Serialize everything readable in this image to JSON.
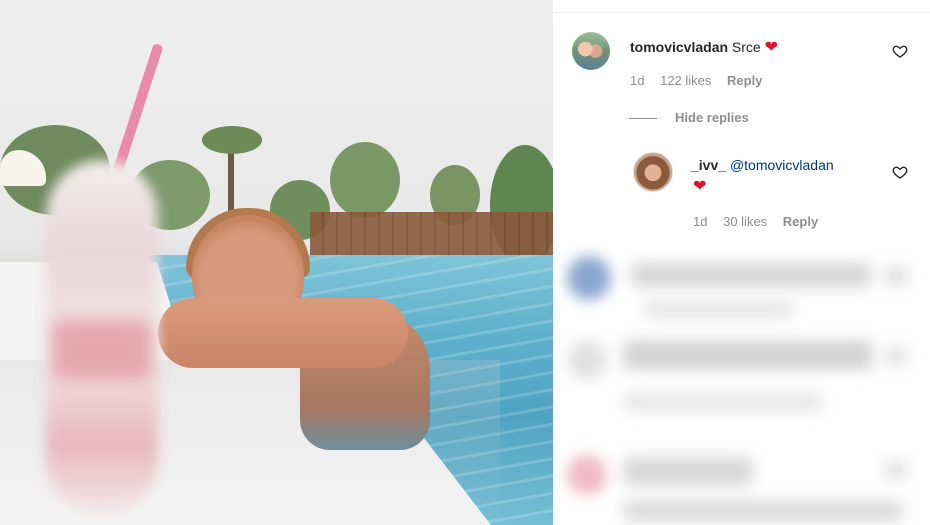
{
  "comments": [
    {
      "username": "tomovicvladan",
      "text": "Srce",
      "emoji": "❤",
      "time": "1d",
      "likes": "122 likes",
      "reply_label": "Reply"
    }
  ],
  "hide_replies_label": "Hide replies",
  "replies": [
    {
      "username": "_ivv_",
      "mention": "@tomovicvladan",
      "emoji": "❤",
      "time": "1d",
      "likes": "30 likes",
      "reply_label": "Reply"
    }
  ],
  "icons": {
    "like": "heart-outline-icon",
    "emoji": "red-heart-emoji"
  },
  "colors": {
    "text": "#262626",
    "meta": "#8e8e8e",
    "mention": "#00376b",
    "heart": "#e0142a"
  }
}
